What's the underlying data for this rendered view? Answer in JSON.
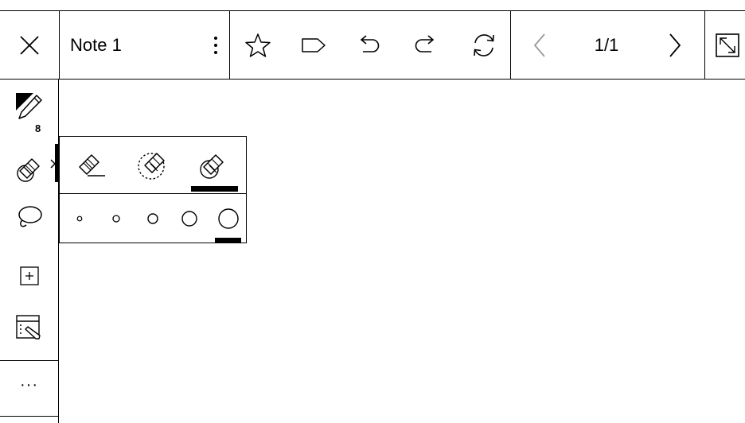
{
  "toolbar": {
    "note_title": "Note 1",
    "page_indicator": "1/1",
    "icons": [
      "close-icon",
      "more-vertical-icon",
      "star-icon",
      "tag-icon",
      "undo-icon",
      "redo-icon",
      "sync-icon",
      "prev-page-icon",
      "next-page-icon",
      "expand-icon"
    ]
  },
  "sidebar": {
    "pen_size": "8",
    "more_label": "···",
    "icons": [
      "pen-icon",
      "eraser-icon",
      "lasso-icon",
      "add-page-icon",
      "template-icon"
    ]
  },
  "eraser_popup": {
    "modes": [
      "stroke-eraser",
      "lasso-eraser",
      "area-eraser"
    ],
    "selected_mode": "area-eraser",
    "sizes": [
      1,
      2,
      3,
      4,
      5
    ],
    "selected_size": 5
  }
}
